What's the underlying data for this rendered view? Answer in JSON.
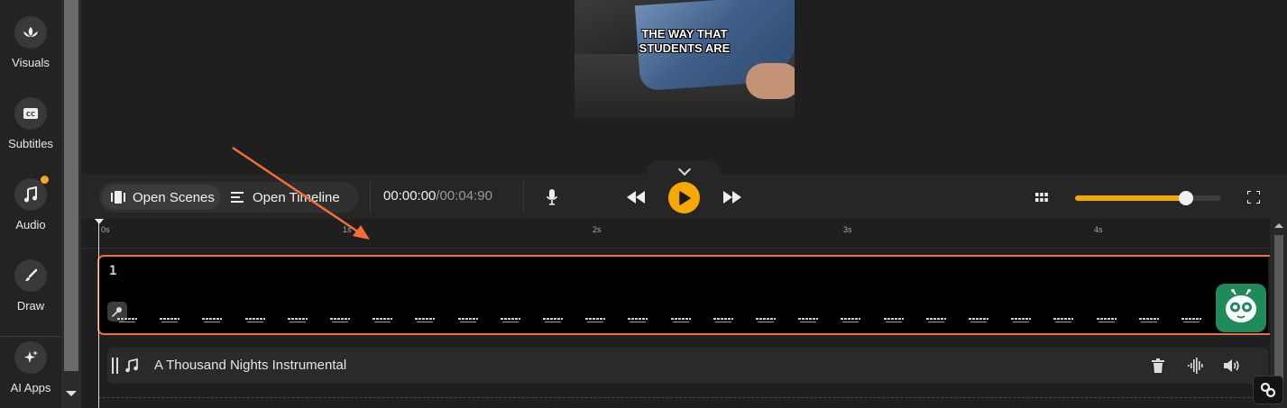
{
  "sidebar": {
    "items": [
      {
        "label": "Visuals",
        "icon": "lotus-icon"
      },
      {
        "label": "Subtitles",
        "icon": "cc-icon"
      },
      {
        "label": "Audio",
        "icon": "music-note-icon"
      },
      {
        "label": "Draw",
        "icon": "brush-icon"
      },
      {
        "label": "AI Apps",
        "icon": "sparkle-icon"
      }
    ]
  },
  "preview": {
    "caption_line1": "THE WAY THAT",
    "caption_line2": "STUDENTS ARE"
  },
  "toolbar": {
    "open_scenes_label": "Open Scenes",
    "open_timeline_label": "Open Timeline",
    "time_current": "00:00:00",
    "time_total": "/00:04:90",
    "volume_level": 0.76
  },
  "timeline": {
    "ticks": [
      "0s",
      "1s",
      "2s",
      "3s",
      "4s"
    ],
    "subtitle_track_number": "1",
    "audio_track_title": "A Thousand Nights Instrumental"
  },
  "colors": {
    "accent": "#f5a800",
    "highlight": "#f26f3a",
    "assistant": "#1f8a5c"
  }
}
